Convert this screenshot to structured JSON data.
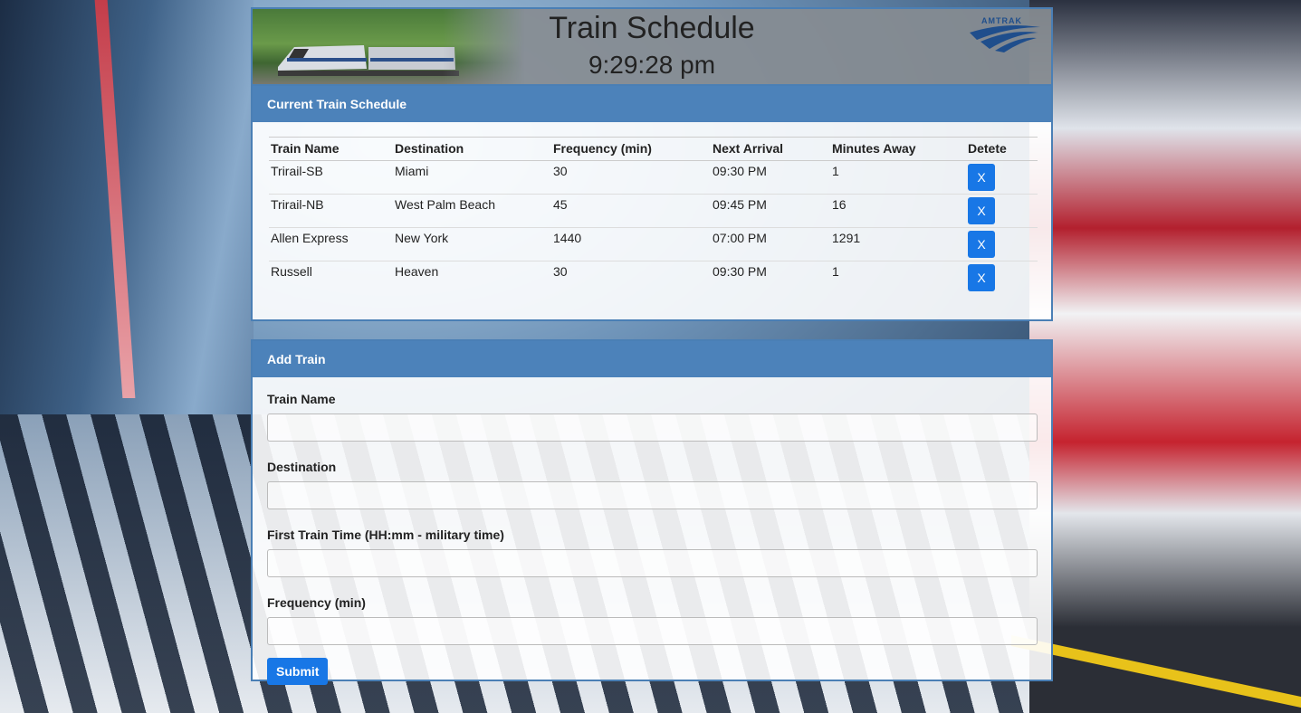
{
  "header": {
    "title": "Train Schedule",
    "clock": "9:29:28 pm",
    "logo_text": "AMTRAK"
  },
  "schedule": {
    "heading": "Current Train Schedule",
    "columns": [
      "Train Name",
      "Destination",
      "Frequency (min)",
      "Next Arrival",
      "Minutes Away",
      "Detete"
    ],
    "rows": [
      {
        "name": "Trirail-SB",
        "destination": "Miami",
        "frequency": "30",
        "next_arrival": "09:30 PM",
        "minutes_away": "1",
        "delete_label": "X"
      },
      {
        "name": "Trirail-NB",
        "destination": "West Palm Beach",
        "frequency": "45",
        "next_arrival": "09:45 PM",
        "minutes_away": "16",
        "delete_label": "X"
      },
      {
        "name": "Allen Express",
        "destination": "New York",
        "frequency": "1440",
        "next_arrival": "07:00 PM",
        "minutes_away": "1291",
        "delete_label": "X"
      },
      {
        "name": "Russell",
        "destination": "Heaven",
        "frequency": "30",
        "next_arrival": "09:30 PM",
        "minutes_away": "1",
        "delete_label": "X"
      }
    ]
  },
  "add_train": {
    "heading": "Add Train",
    "fields": {
      "train_name": {
        "label": "Train Name",
        "value": ""
      },
      "destination": {
        "label": "Destination",
        "value": ""
      },
      "first_train_time": {
        "label": "First Train Time (HH:mm - military time)",
        "value": ""
      },
      "frequency": {
        "label": "Frequency (min)",
        "value": ""
      }
    },
    "submit_label": "Submit"
  },
  "colors": {
    "panel_heading": "#4c82ba",
    "button": "#1877e6",
    "border": "#4a7fb5"
  }
}
